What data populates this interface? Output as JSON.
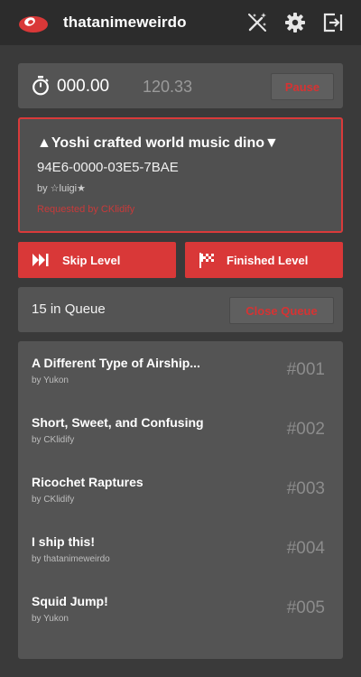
{
  "header": {
    "username": "thatanimeweirdo",
    "icons": [
      "logo-icon",
      "magic-wand-icon",
      "gear-icon",
      "exit-icon"
    ]
  },
  "timer": {
    "main": "000.00",
    "secondary": "120.33",
    "pause_label": "Pause"
  },
  "current_level": {
    "title": "▲Yoshi crafted world music dino▼",
    "code": "94E6-0000-03E5-7BAE",
    "author": "by ☆luigi★",
    "requested": "Requested by CKlidify"
  },
  "actions": {
    "skip_label": "Skip Level",
    "finished_label": "Finished Level"
  },
  "queue": {
    "count_label": "15 in Queue",
    "close_label": "Close Queue",
    "items": [
      {
        "title": "A Different Type of Airship...",
        "author": "by Yukon",
        "number": "#001"
      },
      {
        "title": "Short, Sweet, and Confusing",
        "author": "by CKlidify",
        "number": "#002"
      },
      {
        "title": "Ricochet Raptures",
        "author": "by CKlidify",
        "number": "#003"
      },
      {
        "title": "I ship this!",
        "author": "by thatanimeweirdo",
        "number": "#004"
      },
      {
        "title": "Squid Jump!",
        "author": "by Yukon",
        "number": "#005"
      }
    ]
  },
  "colors": {
    "accent": "#d93838",
    "header_bg": "#2c2c2c",
    "page_bg": "#3a3a3a",
    "card_bg": "#545454"
  }
}
